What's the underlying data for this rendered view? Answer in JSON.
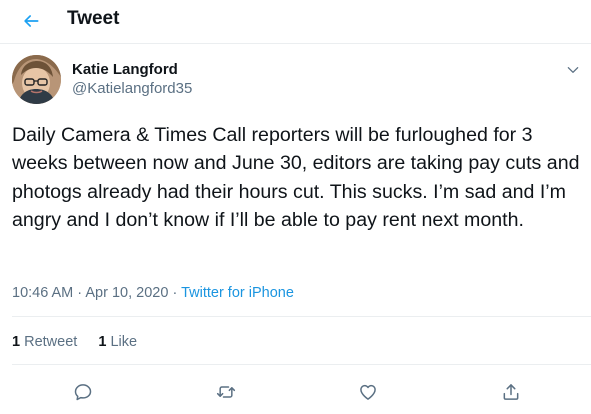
{
  "header": {
    "title": "Tweet"
  },
  "tweet": {
    "author_name": "Katie Langford",
    "author_handle": "@Katielangford35",
    "text": "Daily Camera & Times Call reporters will be furloughed for 3 weeks between now and June 30, editors are taking pay cuts and photogs already had their hours cut. This sucks. I’m sad and I’m angry and I don’t know if I’ll be able to pay rent next month.",
    "time": "10:46 AM",
    "date": "Apr 10, 2020",
    "separator": "·",
    "source": "Twitter for iPhone"
  },
  "stats": {
    "retweets_count": "1",
    "retweets_label": "Retweet",
    "likes_count": "1",
    "likes_label": "Like"
  },
  "icons": {
    "back": "arrow-left-icon",
    "more": "chevron-down-icon",
    "reply": "reply-icon",
    "retweet": "retweet-icon",
    "like": "heart-icon",
    "share": "share-icon"
  },
  "colors": {
    "accent": "#1da1f2",
    "link": "#1b95e0",
    "secondary_text": "#5b7083",
    "divider": "#ebeef0"
  }
}
